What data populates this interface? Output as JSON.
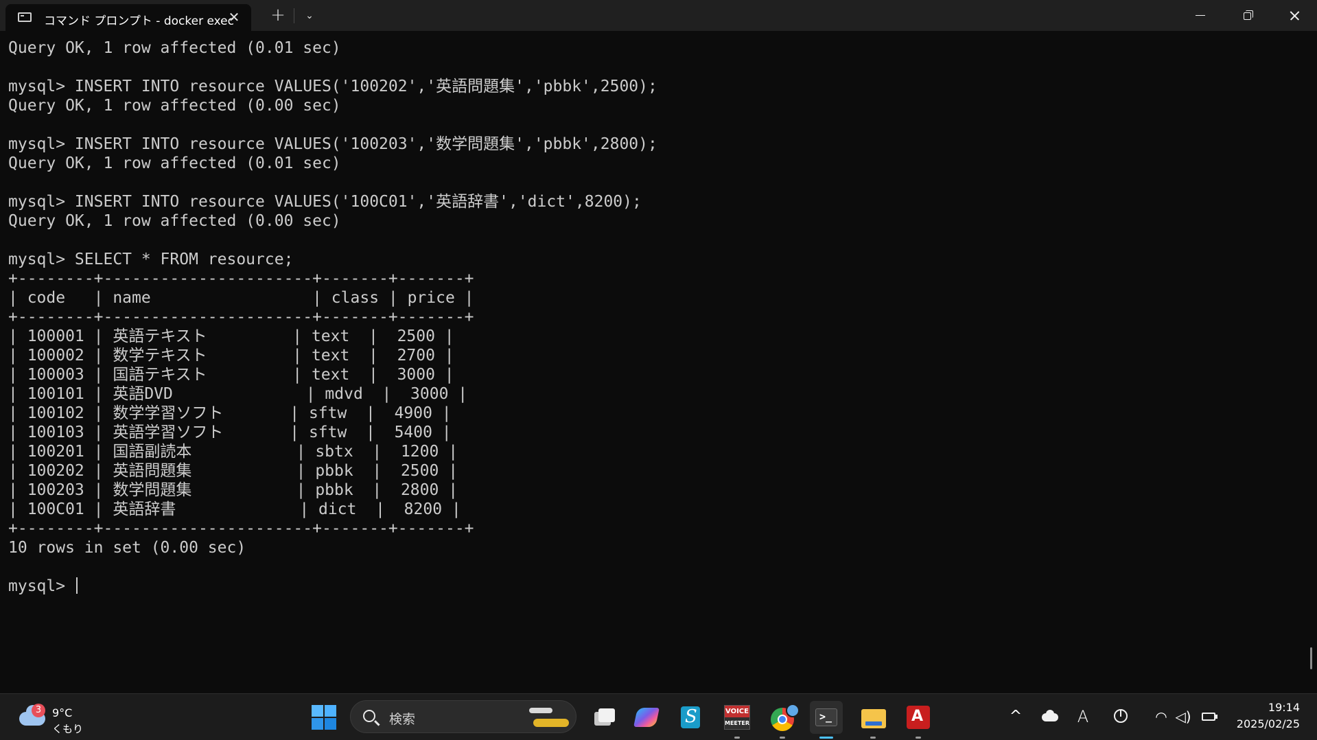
{
  "window": {
    "tab_title": "コマンド プロンプト - docker  exec",
    "tab_close_glyph": "✕",
    "new_tab_glyph": "+",
    "dropdown_glyph": "⌄"
  },
  "terminal": {
    "lines": [
      "Query OK, 1 row affected (0.01 sec)",
      "",
      "mysql> INSERT INTO resource VALUES('100202','英語問題集','pbbk',2500);",
      "Query OK, 1 row affected (0.00 sec)",
      "",
      "mysql> INSERT INTO resource VALUES('100203','数学問題集','pbbk',2800);",
      "Query OK, 1 row affected (0.01 sec)",
      "",
      "mysql> INSERT INTO resource VALUES('100C01','英語辞書','dict',8200);",
      "Query OK, 1 row affected (0.00 sec)",
      "",
      "mysql> SELECT * FROM resource;",
      "+--------+----------------------+-------+-------+",
      "| code   | name                 | class | price |",
      "+--------+----------------------+-------+-------+",
      "| 100001 | 英語テキスト         | text  |  2500 |",
      "| 100002 | 数学テキスト         | text  |  2700 |",
      "| 100003 | 国語テキスト         | text  |  3000 |",
      "| 100101 | 英語DVD              | mdvd  |  3000 |",
      "| 100102 | 数学学習ソフト       | sftw  |  4900 |",
      "| 100103 | 英語学習ソフト       | sftw  |  5400 |",
      "| 100201 | 国語副読本           | sbtx  |  1200 |",
      "| 100202 | 英語問題集           | pbbk  |  2500 |",
      "| 100203 | 数学問題集           | pbbk  |  2800 |",
      "| 100C01 | 英語辞書             | dict  |  8200 |",
      "+--------+----------------------+-------+-------+",
      "10 rows in set (0.00 sec)",
      ""
    ],
    "prompt": "mysql> "
  },
  "taskbar": {
    "weather": {
      "badge": "3",
      "temperature": "9°C",
      "condition": "くもり"
    },
    "search_placeholder": "検索",
    "voicemeeter": {
      "top": "VOICE",
      "bottom": "MEETER"
    },
    "sticky_glyph": "S",
    "terminal_glyph": ">_",
    "acrobat_glyph": "A",
    "tray": {
      "chevron": "^",
      "ime": "A",
      "wifi": "◠",
      "volume": "◁)"
    },
    "clock": {
      "time": "19:14",
      "date": "2025/02/25"
    }
  }
}
